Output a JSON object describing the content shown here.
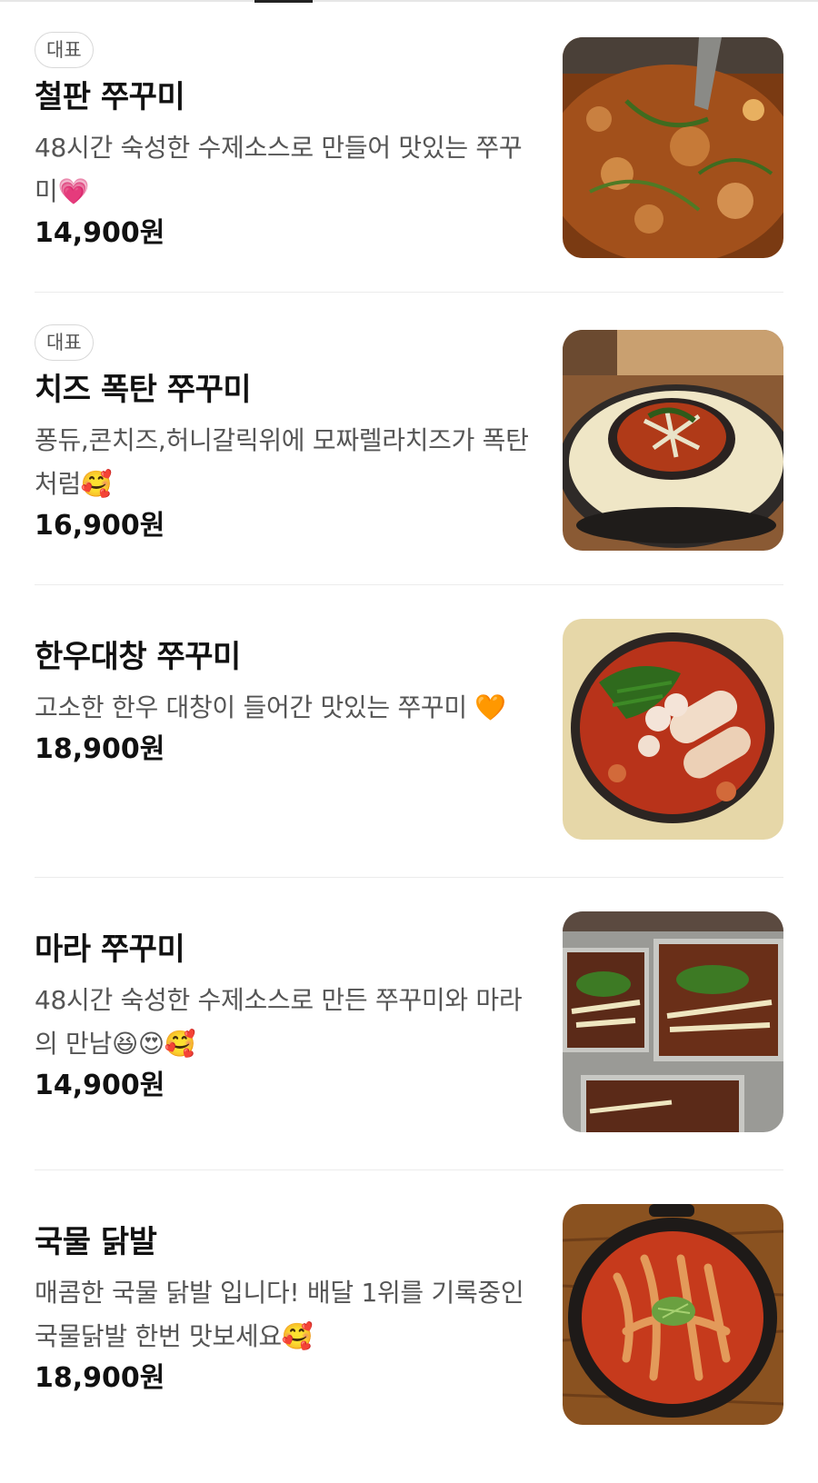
{
  "menu": {
    "items": [
      {
        "badge": "대표",
        "name": "철판 쭈꾸미",
        "description": "48시간 숙성한 수제소스로 만들어 맛있는 쭈꾸미💗",
        "price": "14,900원",
        "image_icon": "stir-fried-octopus-photo"
      },
      {
        "badge": "대표",
        "name": "치즈 폭탄 쭈꾸미",
        "description": "퐁듀,콘치즈,허니갈릭위에 모짜렐라치즈가 폭탄처럼🥰",
        "price": "16,900원",
        "image_icon": "cheese-octopus-pan-photo"
      },
      {
        "badge": "",
        "name": "한우대창 쭈꾸미",
        "description": "고소한 한우 대창이 들어간 맛있는 쭈꾸미 🧡",
        "price": "18,900원",
        "image_icon": "beef-tripe-octopus-photo"
      },
      {
        "badge": "",
        "name": "마라 쭈꾸미",
        "description": "48시간 숙성한 수제소스로 만든 쭈꾸미와 마라의 만남😆😍🥰",
        "price": "14,900원",
        "image_icon": "mala-octopus-trays-photo"
      },
      {
        "badge": "",
        "name": "국물 닭발",
        "description": "매콤한 국물 닭발 입니다! 배달 1위를 기록중인 국물닭발 한번 맛보세요🥰",
        "price": "18,900원",
        "image_icon": "spicy-chicken-feet-soup-photo"
      }
    ]
  }
}
